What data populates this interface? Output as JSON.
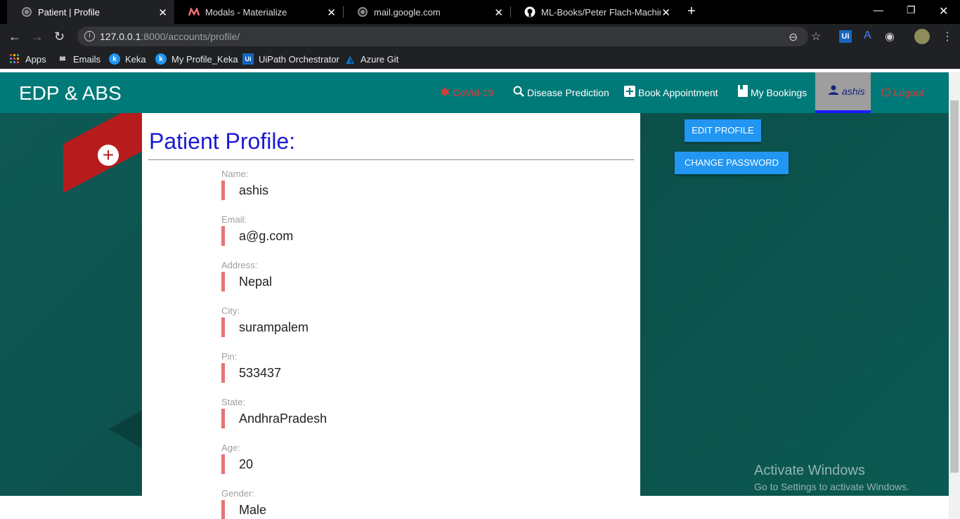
{
  "browser": {
    "tabs": [
      {
        "title": "Patient | Profile",
        "favicon": "globe-icon"
      },
      {
        "title": "Modals - Materialize",
        "favicon": "materialize-icon"
      },
      {
        "title": "mail.google.com",
        "favicon": "globe-icon"
      },
      {
        "title": "ML-Books/Peter Flach-Machine L",
        "favicon": "github-icon"
      }
    ],
    "url_host": "127.0.0.1",
    "url_rest": ":8000/accounts/profile/",
    "bookmarks": [
      {
        "label": "Apps",
        "icon": "apps-grid-icon"
      },
      {
        "label": "Emails",
        "icon": "mail-icon"
      },
      {
        "label": "Keka",
        "icon": "keka-icon"
      },
      {
        "label": "My Profile_Keka",
        "icon": "keka-icon"
      },
      {
        "label": "UiPath Orchestrator",
        "icon": "uipath-icon"
      },
      {
        "label": "Azure Git",
        "icon": "azure-icon"
      }
    ]
  },
  "navbar": {
    "brand": "EDP & ABS",
    "items": [
      {
        "label": "CoVid-19",
        "icon": "virus-icon"
      },
      {
        "label": "Disease Prediction",
        "icon": "search-icon"
      },
      {
        "label": "Book Appointment",
        "icon": "plus-box-icon"
      },
      {
        "label": "My Bookings",
        "icon": "bookmark-icon"
      },
      {
        "label": "ashis",
        "icon": "person-icon"
      },
      {
        "label": "Logout",
        "icon": "power-icon"
      }
    ]
  },
  "profile": {
    "title": "Patient Profile:",
    "fields": [
      {
        "label": "Name:",
        "value": "ashis"
      },
      {
        "label": "Email:",
        "value": "a@g.com"
      },
      {
        "label": "Address:",
        "value": "Nepal"
      },
      {
        "label": "City:",
        "value": "surampalem"
      },
      {
        "label": "Pin:",
        "value": "533437"
      },
      {
        "label": "State:",
        "value": "AndhraPradesh"
      },
      {
        "label": "Age:",
        "value": "20"
      },
      {
        "label": "Gender:",
        "value": "Male"
      }
    ]
  },
  "actions": {
    "edit_profile": "EDIT PROFILE",
    "change_password": "CHANGE PASSWORD"
  },
  "watermark": {
    "line1": "Activate Windows",
    "line2": "Go to Settings to activate Windows."
  },
  "colors": {
    "navbar": "#007a78",
    "title_blue": "#1a1ad6",
    "button_blue": "#2196f3",
    "field_accent": "#e57373"
  }
}
